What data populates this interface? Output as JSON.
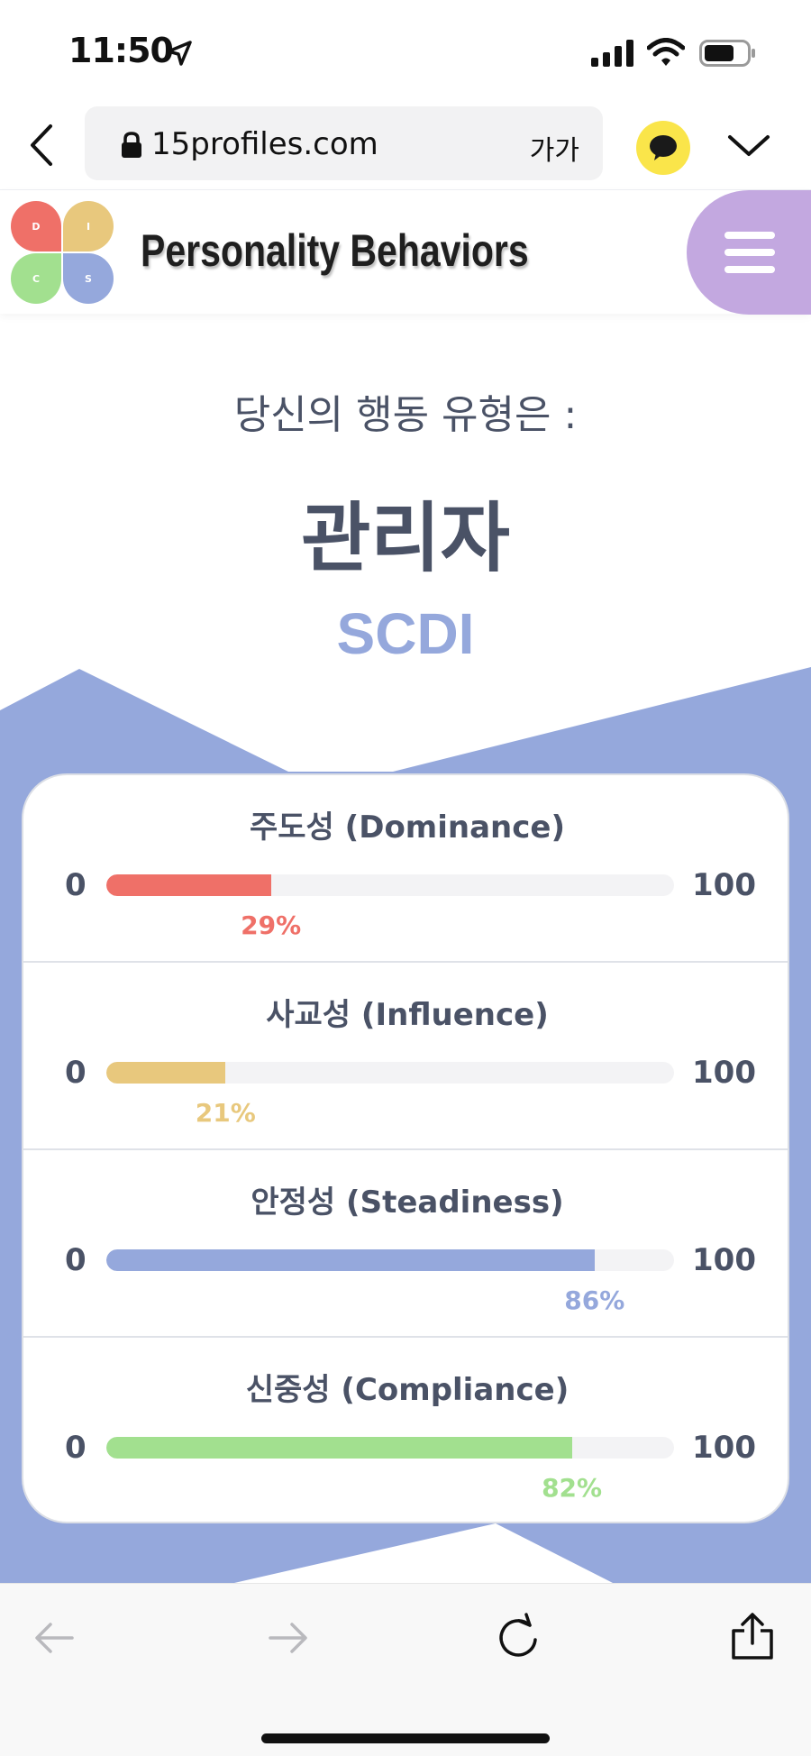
{
  "status_bar": {
    "time": "11:50"
  },
  "browser": {
    "url": "15profiles.com",
    "text_size_label": "가가"
  },
  "site": {
    "title": "Personality Behaviors",
    "logo_letters": [
      "D",
      "I",
      "C",
      "S"
    ]
  },
  "result": {
    "intro": "당신의 행동 유형은 :",
    "type_name": "관리자",
    "code": "SCDI"
  },
  "traits": [
    {
      "title": "주도성 (Dominance)",
      "min": "0",
      "max": "100",
      "percent": 29,
      "percent_label": "29%",
      "color": "#ef7068"
    },
    {
      "title": "사교성 (Influence)",
      "min": "0",
      "max": "100",
      "percent": 21,
      "percent_label": "21%",
      "color": "#e8c87d"
    },
    {
      "title": "안정성 (Steadiness)",
      "min": "0",
      "max": "100",
      "percent": 86,
      "percent_label": "86%",
      "color": "#95a8dc"
    },
    {
      "title": "신중성 (Compliance)",
      "min": "0",
      "max": "100",
      "percent": 82,
      "percent_label": "82%",
      "color": "#a2e08f"
    }
  ],
  "icons": {
    "status": [
      "location-arrow-icon",
      "cellular-signal-icon",
      "wifi-icon",
      "battery-icon"
    ],
    "browser": [
      "back-chevron-icon",
      "lock-icon",
      "kakaotalk-icon",
      "collapse-chevron-icon"
    ],
    "toolbar": [
      "back-arrow-icon",
      "forward-arrow-icon",
      "reload-icon",
      "share-icon"
    ],
    "header": [
      "menu-icon"
    ]
  }
}
